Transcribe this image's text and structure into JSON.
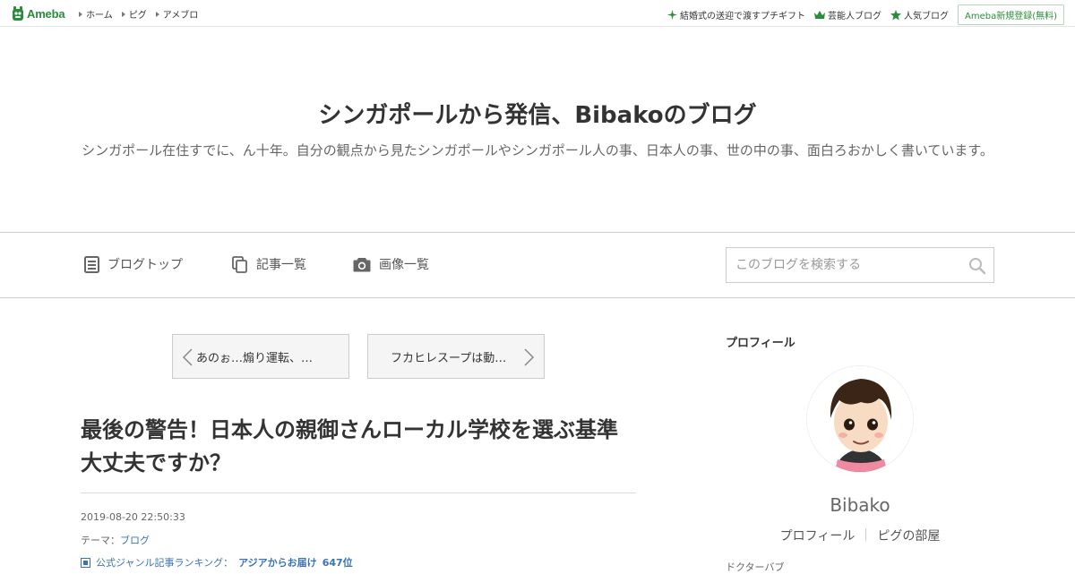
{
  "topbar": {
    "logo": "Ameba",
    "nav": [
      "ホーム",
      "ピグ",
      "アメブロ"
    ],
    "right_links": [
      "結婚式の送迎で渡すプチギフト",
      "芸能人ブログ",
      "人気ブログ"
    ],
    "register_label": "Ameba新規登録(無料)"
  },
  "header": {
    "title": "シンガポールから発信、Bibakoのブログ",
    "description": "シンガポール在住すでに、ん十年。自分の観点から見たシンガポールやシンガポール人の事、日本人の事、世の中の事、面白ろおかしく書いています。"
  },
  "navbar": {
    "blog_top": "ブログトップ",
    "articles": "記事一覧",
    "images": "画像一覧",
    "search_placeholder": "このブログを検索する"
  },
  "pager": {
    "prev": "あのぉ…煽り運転、…",
    "next": "フカヒレスープは動…"
  },
  "article": {
    "title": "最後の警告！日本人の親御さんローカル学校を選ぶ基準大丈夫ですか？",
    "date": "2019-08-20 22:50:33",
    "theme_label": "テーマ：",
    "theme_link": "ブログ",
    "ranking_label": "公式ジャンル記事ランキング：",
    "ranking_value": "アジアからお届け",
    "ranking_rank": "647位"
  },
  "sidebar": {
    "heading": "プロフィール",
    "name": "Bibako",
    "profile_link": "プロフィール",
    "pigg_link": "ピグの部屋",
    "cut_text": "ドクターバブ"
  },
  "colors": {
    "brand": "#2d8c3c",
    "link": "#3a72b4"
  }
}
